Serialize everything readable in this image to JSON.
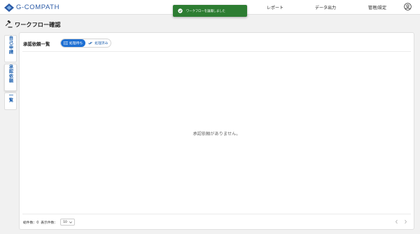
{
  "header": {
    "logo_text": "G-COMPATH",
    "nav": [
      "レポート",
      "データ出力",
      "管理/設定"
    ]
  },
  "toast": {
    "message": "ワークフローを論識しました"
  },
  "page": {
    "title": "ワークフロー確認"
  },
  "side_tabs": [
    "自己申請",
    "承認依頼",
    "一覧"
  ],
  "panel": {
    "title": "承認依頼一覧",
    "tabs": [
      {
        "label": "処理待ち",
        "active": true
      },
      {
        "label": "処理済み",
        "active": false
      }
    ],
    "empty_message": "承認依頼がありません。"
  },
  "footer": {
    "total_label": "総件数：0",
    "display_label": "表示件数：",
    "page_size": "10"
  },
  "colors": {
    "brand": "#2b5aa6",
    "accent": "#1d6fd3",
    "toast": "#2d7d32"
  }
}
